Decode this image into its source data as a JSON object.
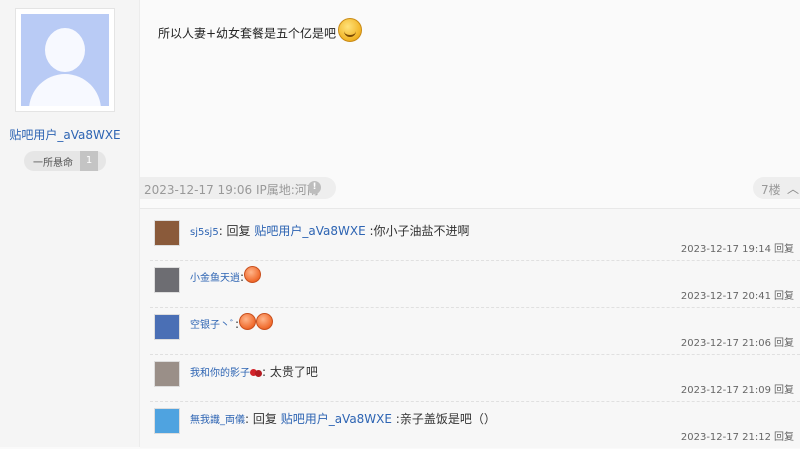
{
  "post": {
    "author": {
      "username": "贴吧用户_aVa8WXE",
      "level_title": "一所悬命",
      "level_num": "1"
    },
    "text": "所以人妻+幼女套餐是五个亿是吧",
    "emoji": "smile-emoji",
    "meta": "2023-12-17 19:06 IP属地:河南",
    "info_icon": "!",
    "floor": "7楼",
    "collapse_glyph": "^"
  },
  "replies": [
    {
      "nick": "sj5sj5",
      "avatar_color": "#8a5a3a",
      "prefix": ": 回复 ",
      "target": "贴吧用户_aVa8WXE",
      "content": " :你小子油盐不进啊",
      "emojis": [],
      "time": "2023-12-17 19:14",
      "reply_label": "回复"
    },
    {
      "nick": "小金鱼天逍",
      "avatar_color": "#6d6d72",
      "prefix": ":",
      "target": "",
      "content": "",
      "emojis": [
        "peach-emoji"
      ],
      "time": "2023-12-17 20:41",
      "reply_label": "回复"
    },
    {
      "nick": "空银子丶ﾞ",
      "avatar_color": "#4a6fb5",
      "prefix": ":",
      "target": "",
      "content": "",
      "emojis": [
        "peach-emoji",
        "peach-emoji"
      ],
      "time": "2023-12-17 21:06",
      "reply_label": "回复"
    },
    {
      "nick": "我和你的影子",
      "avatar_color": "#9a8f88",
      "prefix": ": ",
      "target": "",
      "content": "太贵了吧",
      "emojis": [
        "cherry-emoji"
      ],
      "time": "2023-12-17 21:09",
      "reply_label": "回复"
    },
    {
      "nick": "無我識_両儀",
      "avatar_color": "#4fa3e0",
      "prefix": ": 回复 ",
      "target": "贴吧用户_aVa8WXE",
      "content": " :亲子盖饭是吧（）",
      "emojis": [],
      "time": "2023-12-17 21:12",
      "reply_label": "回复"
    }
  ]
}
